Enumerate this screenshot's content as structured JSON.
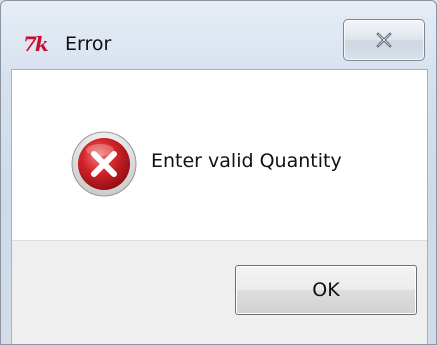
{
  "window": {
    "title": "Error",
    "app_icon": "tk-feather-icon",
    "close_icon": "close-x-icon"
  },
  "dialog": {
    "icon": "error-icon",
    "message": "Enter valid Quantity",
    "ok_label": "OK"
  },
  "colors": {
    "error_red": "#c8102e",
    "title_bar": "#d7e1ee"
  }
}
